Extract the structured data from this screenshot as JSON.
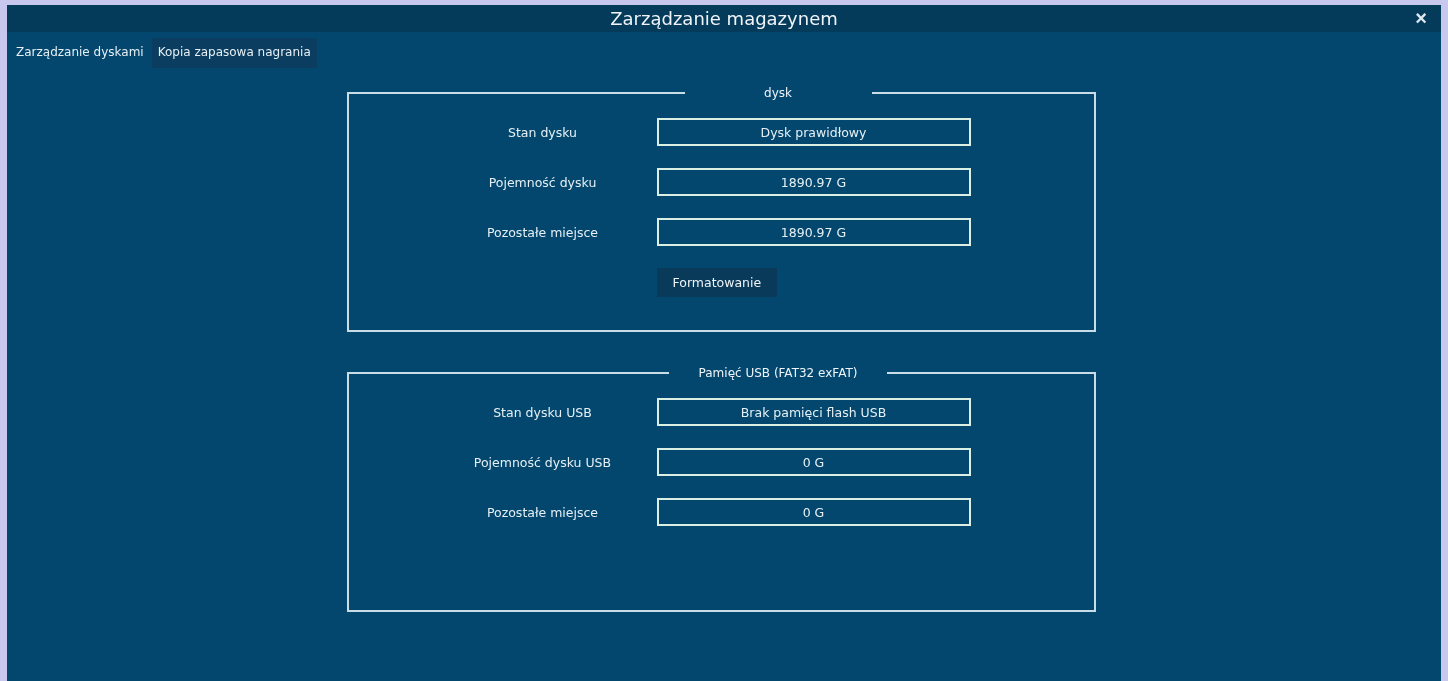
{
  "window": {
    "title": "Zarządzanie magazynem",
    "close": "×"
  },
  "tabs": [
    {
      "label": "Zarządzanie dyskami",
      "selected": true
    },
    {
      "label": "Kopia zapasowa nagrania",
      "selected": false
    }
  ],
  "sections": [
    {
      "title": "dysk",
      "rows": [
        {
          "label": "Stan dysku",
          "value": "Dysk prawidłowy"
        },
        {
          "label": "Pojemność dysku",
          "value": "1890.97 G"
        },
        {
          "label": "Pozostałe miejsce",
          "value": "1890.97 G"
        }
      ],
      "button": "Formatowanie"
    },
    {
      "title": "Pamięć USB (FAT32 exFAT)",
      "rows": [
        {
          "label": "Stan dysku USB",
          "value": "Brak pamięci flash USB"
        },
        {
          "label": "Pojemność dysku USB",
          "value": "0 G"
        },
        {
          "label": "Pozostałe miejsce",
          "value": "0 G"
        }
      ]
    }
  ]
}
